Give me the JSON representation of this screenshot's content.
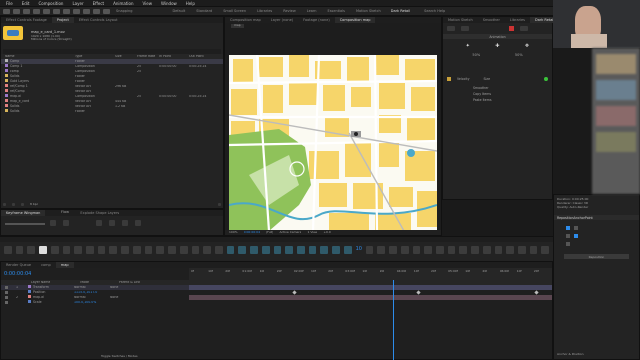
{
  "menu": [
    "File",
    "Edit",
    "Composition",
    "Layer",
    "Effect",
    "Animation",
    "View",
    "Window",
    "Help"
  ],
  "toolbar": {
    "snapping_label": "Snapping",
    "workspaces": [
      "Default",
      "Standard",
      "Small Screen",
      "Libraries",
      "Review",
      "Learn",
      "Essentials",
      "Motion Sketch"
    ],
    "active_workspace": "Dark Retail",
    "search_placeholder": "Search Help"
  },
  "project": {
    "tabs": [
      "Effect Controls Footage",
      "Project",
      "Effect Controls Layout"
    ],
    "selected_name": "map_e_card_1.mov",
    "selected_info1": "1920 x 1080 (1.00)",
    "selected_info2": "Millions of Colors (Straight)",
    "columns": [
      "Name",
      "Type",
      "Size",
      "Frame Rate",
      "In Point",
      "Out Point"
    ],
    "items": [
      {
        "name": "Comp",
        "type": "Folder",
        "size": "",
        "fps": "",
        "in": "",
        "out": "",
        "color": "#b5b5b5"
      },
      {
        "name": "Comp 1",
        "type": "Composition",
        "size": "",
        "fps": "25",
        "in": "0:00:00:00",
        "out": "0:00:25:24",
        "color": "#9a77c7"
      },
      {
        "name": "comp",
        "type": "Composition",
        "size": "",
        "fps": "25",
        "in": "",
        "out": "",
        "color": "#9a77c7"
      },
      {
        "name": "Solids",
        "type": "Folder",
        "size": "",
        "fps": "",
        "in": "",
        "out": "",
        "color": "#d6b35a"
      },
      {
        "name": "Gold Layers",
        "type": "Folder",
        "size": "",
        "fps": "",
        "in": "",
        "out": "",
        "color": "#d6b35a"
      },
      {
        "name": "ref/Comp 1",
        "type": "Vector Art",
        "size": "296 KB",
        "fps": "",
        "in": "",
        "out": "",
        "color": "#e08080"
      },
      {
        "name": "ref/Comp",
        "type": "Vector Art",
        "size": "",
        "fps": "",
        "in": "",
        "out": "",
        "color": "#e08080"
      },
      {
        "name": "map.ai",
        "type": "Composition",
        "size": "",
        "fps": "25",
        "in": "0:00:00:00",
        "out": "0:00:25:24",
        "color": "#9a77c7"
      },
      {
        "name": "map_e_card",
        "type": "Vector Art",
        "size": "444 KB",
        "fps": "",
        "in": "",
        "out": "",
        "color": "#e08080"
      },
      {
        "name": "Solids",
        "type": "Vector Art",
        "size": "1.2 KB",
        "fps": "",
        "in": "",
        "out": "",
        "color": "#e08080"
      },
      {
        "name": "Solids",
        "type": "Folder",
        "size": "",
        "fps": "",
        "in": "",
        "out": "",
        "color": "#d6b35a"
      }
    ],
    "bpc": "8 bpc"
  },
  "comp": {
    "tabs": [
      "Composition map",
      "Layer (none)",
      "Footage (none)",
      "Composition map"
    ],
    "breadcrumb": "map",
    "zoom": "100%",
    "timecode": "0:00:00:04",
    "quality": "(Full)",
    "camera": "Active Camera",
    "view": "1 View",
    "status": "+0.0"
  },
  "right": {
    "tabs": [
      "Motion Sketch",
      "Smoother",
      "Libraries",
      "Dark Retail"
    ],
    "animation_title": "Animation",
    "values": [
      "50%",
      "50%"
    ],
    "labels": [
      "Velocity",
      "Size",
      "Smoother",
      "Copy Items",
      "Paste Items"
    ],
    "info_lines": [
      "Duration: 0:00:25:00",
      "Renderer: Classic 3D",
      "Quality: Auto-Render"
    ],
    "mini_title": "RepositionAnchorPoint",
    "mini_button": "Reposition",
    "bottom_label": "Anchor & Position"
  },
  "mid": {
    "keyframe_wingman": "Keyframe Wingman",
    "explode": "Explode Shape Layers",
    "flow": "Flow",
    "auto_label": "Auto",
    "frame_count": "10"
  },
  "timeline": {
    "tabs": [
      "Render Queue",
      "comp",
      "map"
    ],
    "timecode": "0:00:00:04",
    "columns": [
      "Layer Name",
      "Mode",
      "Parent & Link"
    ],
    "layers": [
      {
        "num": "1",
        "name": "Transform",
        "mode": "Normal",
        "parent": "None",
        "color": "#9a77c7"
      },
      {
        "num": "",
        "name": "Position",
        "mode": "1115.0,1017.0",
        "parent": "",
        "color": "#5a7dc7"
      },
      {
        "num": "2",
        "name": "map.ai",
        "mode": "Normal",
        "parent": "None",
        "color": "#e08080"
      },
      {
        "num": "",
        "name": "Scale",
        "mode": "100.0,100.0%",
        "parent": "",
        "color": "#5a7dc7"
      }
    ],
    "ruler": [
      "0f",
      "10f",
      "20f",
      "01:00f",
      "10f",
      "20f",
      "02:00f",
      "10f",
      "20f",
      "03:00f",
      "10f",
      "20f",
      "04:00f",
      "10f",
      "20f",
      "05:00f",
      "10f",
      "20f",
      "06:00f",
      "10f",
      "20f"
    ],
    "footer": "Toggle Switches / Modes"
  },
  "colors": {
    "accent": "#2d8ceb",
    "map_yellow": "#f6d56a",
    "map_green": "#8fc25a",
    "map_water": "#4aa8c9"
  }
}
